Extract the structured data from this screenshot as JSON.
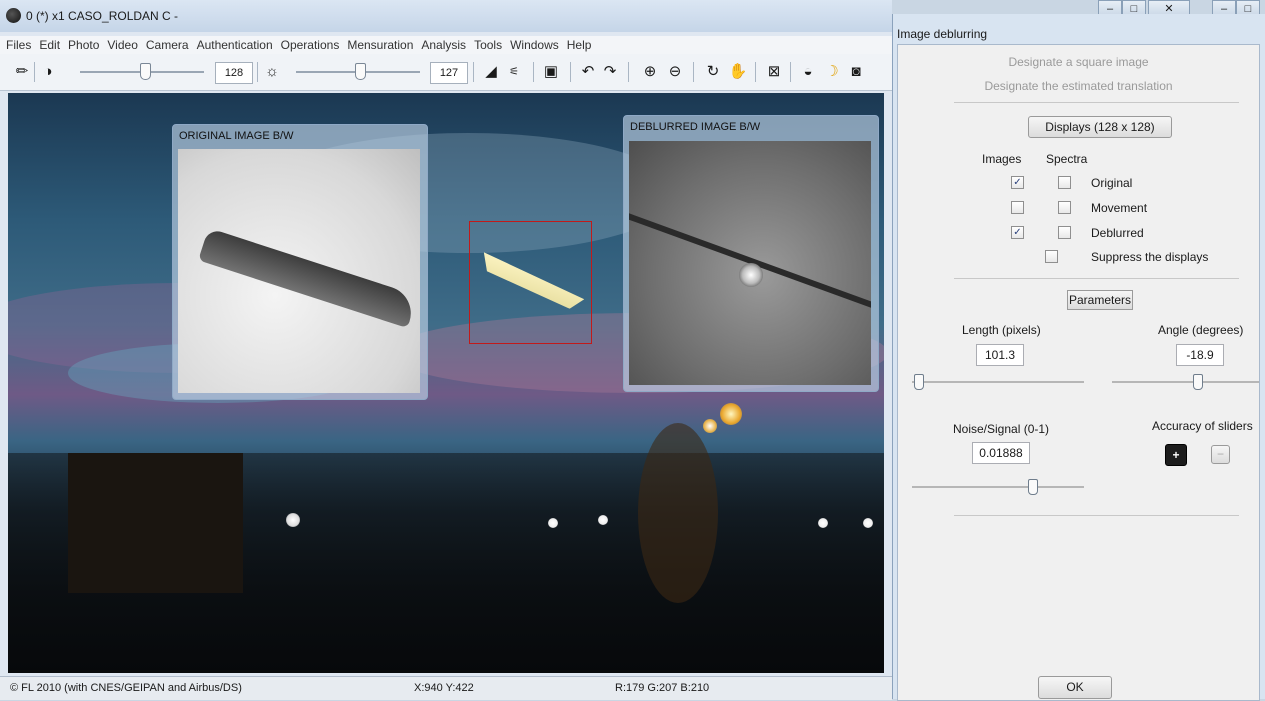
{
  "window": {
    "title": "0 (*)  x1  CASO_ROLDAN C -"
  },
  "menu": [
    "Files",
    "Edit",
    "Photo",
    "Video",
    "Camera",
    "Authentication",
    "Operations",
    "Mensuration",
    "Analysis",
    "Tools",
    "Windows",
    "Help"
  ],
  "toolbar": {
    "contrast_value": "128",
    "brightness_value": "127"
  },
  "panels": {
    "original_title": "ORIGINAL IMAGE B/W",
    "deblurred_title": "DEBLURRED IMAGE B/W"
  },
  "status": {
    "copyright": "© FL 2010 (with CNES/GEIPAN and Airbus/DS)",
    "coords": "X:940  Y:422",
    "rgb": "R:179  G:207  B:210"
  },
  "dialog": {
    "title": "Image deblurring",
    "hint1": "Designate a square image",
    "hint2": "Designate the estimated translation",
    "displays_button": "Displays (128 x 128)",
    "col_images": "Images",
    "col_spectra": "Spectra",
    "rows": [
      {
        "label": "Original",
        "image": true,
        "spectrum": false
      },
      {
        "label": "Movement",
        "image": false,
        "spectrum": false
      },
      {
        "label": "Deblurred",
        "image": true,
        "spectrum": false
      }
    ],
    "suppress_label": "Suppress the displays",
    "parameters_button": "Parameters",
    "length_label": "Length (pixels)",
    "length_value": "101.3",
    "angle_label": "Angle (degrees)",
    "angle_value": "-18.9",
    "noise_label": "Noise/Signal (0-1)",
    "noise_value": "0.01888",
    "accuracy_label": "Accuracy of sliders",
    "ok_label": "OK"
  }
}
